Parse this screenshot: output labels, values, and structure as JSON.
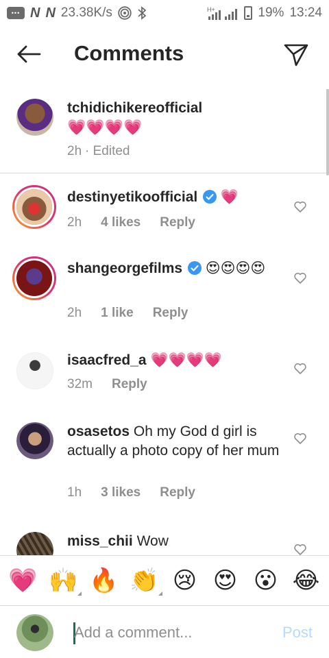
{
  "status_bar": {
    "speed": "23.38K/s",
    "network": "H+",
    "battery": "19%",
    "time": "13:24",
    "icons": [
      "chat-icon",
      "n-icon",
      "n-icon",
      "hotspot-icon",
      "bluetooth-icon",
      "signal-icon",
      "battery-icon"
    ]
  },
  "header": {
    "title": "Comments",
    "back_icon": "arrow-left-icon",
    "share_icon": "paper-plane-icon"
  },
  "caption": {
    "username": "tchidichikereofficial",
    "text": "💗💗💗💗",
    "time": "2h",
    "edited": "· Edited"
  },
  "comments": [
    {
      "username": "destinyetikoofficial",
      "verified": true,
      "text": "💗",
      "time": "2h",
      "likes": "4 likes",
      "reply": "Reply",
      "avatar_color": "#c0392b"
    },
    {
      "username": "shangeorgefilms",
      "verified": true,
      "text": "😍😍😍😍",
      "time": "2h",
      "likes": "1 like",
      "reply": "Reply",
      "avatar_color": "#8e1b1b"
    },
    {
      "username": "isaacfred_a",
      "verified": false,
      "text": "💗💗💗💗",
      "time": "32m",
      "likes": "",
      "reply": "Reply",
      "avatar_color": "#dfe6e9"
    },
    {
      "username": "osasetos",
      "verified": false,
      "text": "Oh my God d girl is actually a photo copy of her mum",
      "time": "1h",
      "likes": "3 likes",
      "reply": "Reply",
      "avatar_color": "#4a3b5c"
    },
    {
      "username": "miss_chii",
      "verified": false,
      "text": "Wow",
      "time": "",
      "likes": "",
      "reply": "",
      "avatar_color": "#5d4e3b"
    }
  ],
  "emoji_bar": [
    "💗",
    "🙌",
    "🔥",
    "👏",
    "😢",
    "😍",
    "😮",
    "😂"
  ],
  "composer": {
    "placeholder": "Add a comment...",
    "post_label": "Post"
  },
  "colors": {
    "text": "#262626",
    "secondary": "#8e8e8e",
    "verified": "#3897f0",
    "post_disabled": "#b3dbff",
    "divider": "#dbdbdb"
  }
}
